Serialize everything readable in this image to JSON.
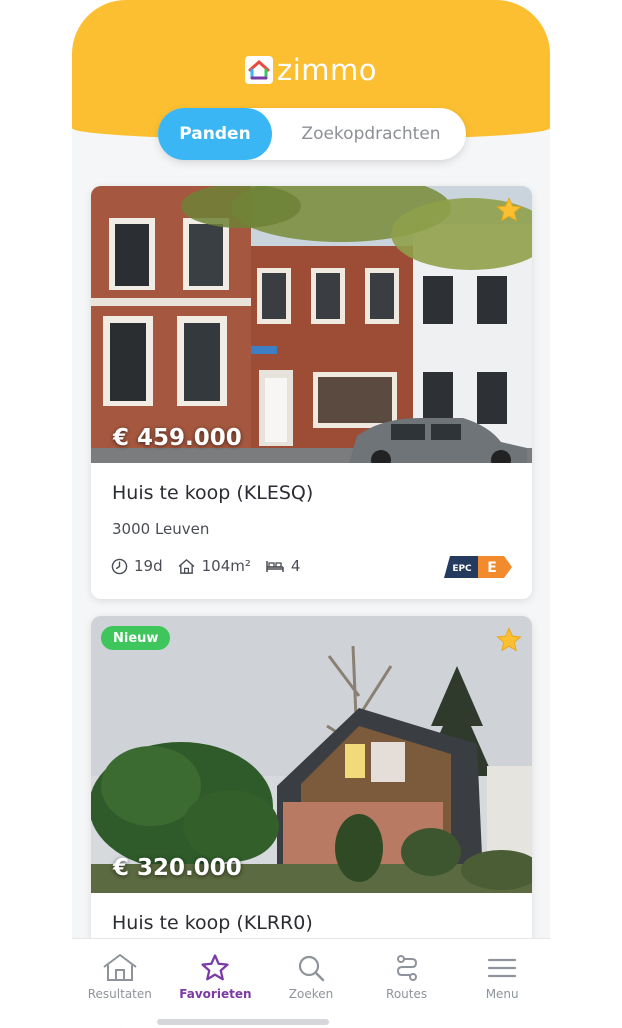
{
  "app": {
    "brand": "zimmo"
  },
  "segments": {
    "active": "Panden",
    "inactive": "Zoekopdrachten"
  },
  "colors": {
    "header": "#fcbf31",
    "accent_blue": "#3bb6f5",
    "active_tab": "#7b3aa6",
    "star": "#fcbf31",
    "new_badge": "#3ec65c",
    "epc_dark": "#243a5e",
    "epc_e": "#f28a2e"
  },
  "listings": [
    {
      "price": "€ 459.000",
      "title": "Huis te koop (KLESQ)",
      "city": "3000 Leuven",
      "age": "19d",
      "area": "104m²",
      "bedrooms": "4",
      "epc_label": "EPC",
      "epc_rating": "E",
      "favorite_icon": "star-icon"
    },
    {
      "badge": "Nieuw",
      "price": "€ 320.000",
      "title": "Huis te koop (KLRR0)",
      "favorite_icon": "star-icon"
    }
  ],
  "tabbar": {
    "items": [
      {
        "label": "Resultaten",
        "icon": "home-icon"
      },
      {
        "label": "Favorieten",
        "icon": "star-outline-icon"
      },
      {
        "label": "Zoeken",
        "icon": "search-icon"
      },
      {
        "label": "Routes",
        "icon": "route-icon"
      },
      {
        "label": "Menu",
        "icon": "menu-icon"
      }
    ]
  }
}
